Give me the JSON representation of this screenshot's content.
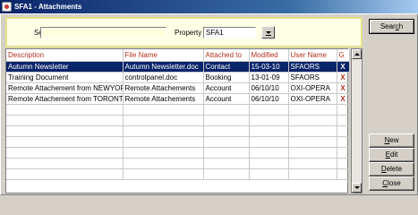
{
  "window": {
    "title": "SFA1 - Attachments"
  },
  "search": {
    "label": "Search",
    "value": "",
    "property_label": "Property",
    "property_value": "SFA1"
  },
  "table": {
    "columns": [
      "Description",
      "File Name",
      "Attached to",
      "Modified",
      "User Name",
      "G"
    ],
    "rows": [
      {
        "description": "Autumn Newsletter",
        "file_name": "Autumn Newsletter.doc",
        "attached_to": "Contact",
        "modified": "15-03-10",
        "user_name": "SFAORS",
        "g": "X",
        "selected": true
      },
      {
        "description": "Training Document",
        "file_name": "controlpanel.doc",
        "attached_to": "Booking",
        "modified": "13-01-09",
        "user_name": "SFAORS",
        "g": "X",
        "selected": false
      },
      {
        "description": "Remote Attachement from NEWYOR",
        "file_name": "Remote Attachements",
        "attached_to": "Account",
        "modified": "06/10/10",
        "user_name": "OXI-OPERA",
        "g": "X",
        "selected": false
      },
      {
        "description": "Remote Attachement from  TORONT",
        "file_name": "Remote Attachements",
        "attached_to": "Account",
        "modified": "06/10/10",
        "user_name": "OXI-OPERA",
        "g": "X",
        "selected": false
      }
    ],
    "empty_rows": 7
  },
  "buttons": {
    "search": {
      "pre": "Sear",
      "key": "c",
      "post": "h"
    },
    "new": {
      "pre": "",
      "key": "N",
      "post": "ew"
    },
    "edit": {
      "pre": "",
      "key": "E",
      "post": "dit"
    },
    "delete": {
      "pre": "",
      "key": "D",
      "post": "elete"
    },
    "close": {
      "pre": "",
      "key": "C",
      "post": "lose"
    }
  },
  "colors": {
    "header_text": "#b3301c",
    "selection": "#0a246a",
    "search_panel": "#ffffe6"
  }
}
